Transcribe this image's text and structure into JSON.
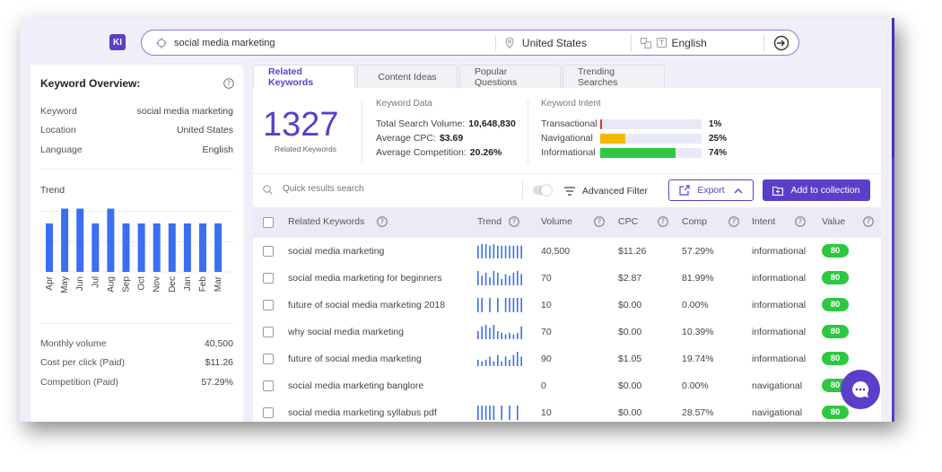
{
  "logo": "KI",
  "search": {
    "query": "social media marketing",
    "location": "United States",
    "language": "English"
  },
  "overview": {
    "title": "Keyword Overview:",
    "rows": [
      {
        "label": "Keyword",
        "value": "social media marketing"
      },
      {
        "label": "Location",
        "value": "United States"
      },
      {
        "label": "Language",
        "value": "English"
      }
    ],
    "trend_label": "Trend",
    "trend": {
      "months": [
        "Apr",
        "May",
        "Jun",
        "Jul",
        "Aug",
        "Sep",
        "Oct",
        "Nov",
        "Dec",
        "Jan",
        "Feb",
        "Mar"
      ],
      "values": [
        72,
        94,
        94,
        72,
        94,
        72,
        72,
        72,
        72,
        72,
        72,
        72
      ],
      "max": 100,
      "color": "#3a6ff0"
    },
    "metrics": [
      {
        "label": "Monthly volume",
        "value": "40,500"
      },
      {
        "label": "Cost per click (Paid)",
        "value": "$11.26"
      },
      {
        "label": "Competition (Paid)",
        "value": "57.29%"
      }
    ]
  },
  "tabs": [
    "Related Keywords",
    "Content Ideas",
    "Popular Questions",
    "Trending Searches"
  ],
  "summary": {
    "count": "1327",
    "count_label": "Related Keywords",
    "keyword_data_title": "Keyword Data",
    "keyword_data": [
      {
        "label": "Total Search Volume:",
        "value": "10,648,830"
      },
      {
        "label": "Average CPC:",
        "value": "$3.69"
      },
      {
        "label": "Average Competition:",
        "value": "20.26%"
      }
    ],
    "intent_title": "Keyword Intent",
    "intent": [
      {
        "label": "Transactional",
        "percent": "1%",
        "fraction": 0.01,
        "color": "#e8323c"
      },
      {
        "label": "Navigational",
        "percent": "25%",
        "fraction": 0.25,
        "color": "#f5b800"
      },
      {
        "label": "Informational",
        "percent": "74%",
        "fraction": 0.74,
        "color": "#2ec840"
      }
    ]
  },
  "toolbar": {
    "quick_search_placeholder": "Quick results search",
    "advanced_filter": "Advanced Filter",
    "export": "Export",
    "add_collection": "Add to collection"
  },
  "table": {
    "headers": [
      "Related Keywords",
      "Trend",
      "Volume",
      "CPC",
      "Comp",
      "Intent",
      "Value"
    ],
    "rows": [
      {
        "keyword": "social media marketing",
        "volume": "40,500",
        "cpc": "$11.26",
        "comp": "57.29%",
        "intent": "informational",
        "value": "80",
        "trend": [
          8,
          9,
          9,
          8,
          9,
          8,
          8,
          8,
          8,
          8,
          8,
          8
        ]
      },
      {
        "keyword": "social media marketing for beginners",
        "volume": "70",
        "cpc": "$2.87",
        "comp": "81.99%",
        "intent": "informational",
        "value": "80",
        "trend": [
          9,
          6,
          8,
          5,
          9,
          8,
          4,
          7,
          6,
          8,
          9,
          7
        ]
      },
      {
        "keyword": "future of social media marketing 2018",
        "volume": "10",
        "cpc": "$0.00",
        "comp": "0.00%",
        "intent": "informational",
        "value": "80",
        "trend": [
          9,
          9,
          0,
          9,
          0,
          9,
          0,
          9,
          9,
          9,
          9,
          9
        ]
      },
      {
        "keyword": "why social media marketing",
        "volume": "70",
        "cpc": "$0.00",
        "comp": "10.39%",
        "intent": "informational",
        "value": "80",
        "trend": [
          5,
          8,
          9,
          7,
          9,
          5,
          4,
          3,
          4,
          3,
          4,
          8
        ]
      },
      {
        "keyword": "future of social media marketing",
        "volume": "90",
        "cpc": "$1.05",
        "comp": "19.74%",
        "intent": "informational",
        "value": "80",
        "trend": [
          4,
          3,
          4,
          6,
          3,
          7,
          3,
          6,
          4,
          7,
          9,
          6
        ]
      },
      {
        "keyword": "social media marketing banglore",
        "volume": "0",
        "cpc": "$0.00",
        "comp": "0.00%",
        "intent": "navigational",
        "value": "80",
        "trend": []
      },
      {
        "keyword": "social media marketing syllabus pdf",
        "volume": "10",
        "cpc": "$0.00",
        "comp": "28.57%",
        "intent": "navigational",
        "value": "80",
        "trend": [
          9,
          9,
          9,
          9,
          9,
          0,
          9,
          0,
          9,
          0,
          9,
          0
        ]
      }
    ]
  },
  "colors": {
    "accent": "#5b3fc9",
    "badge": "#2ec840"
  }
}
